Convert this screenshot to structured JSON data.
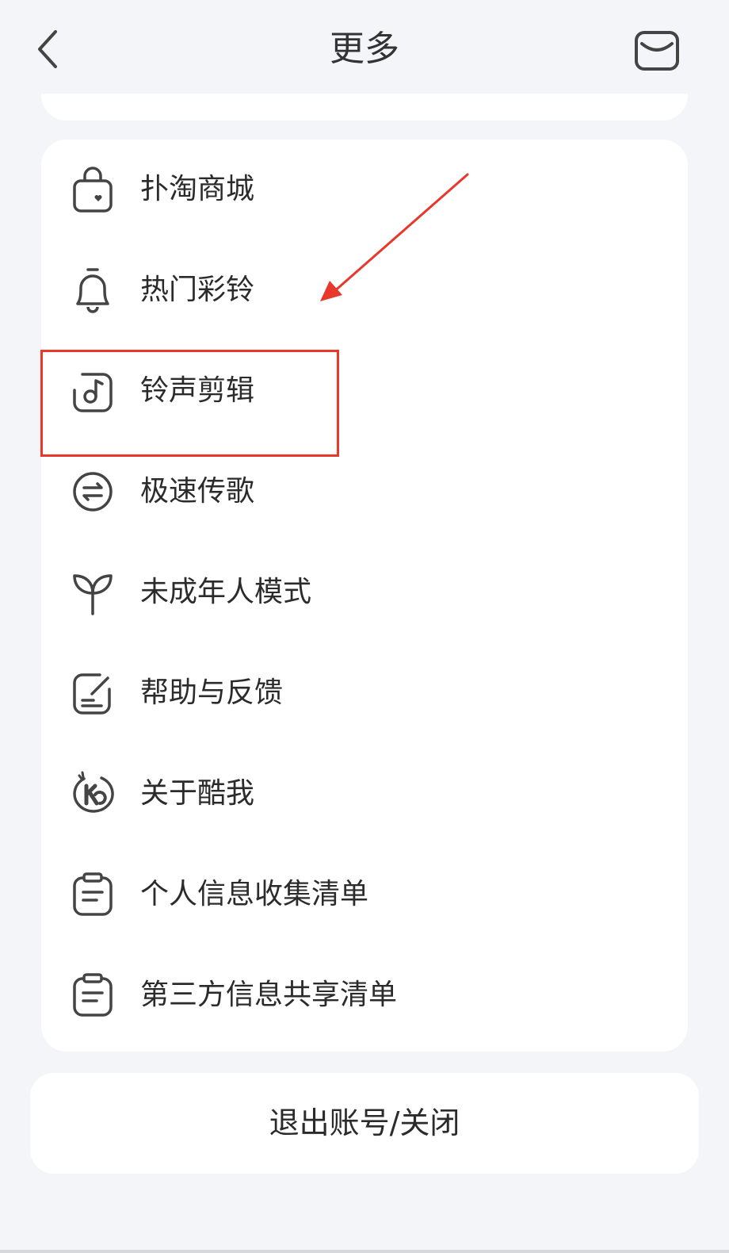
{
  "header": {
    "title": "更多",
    "back_icon": "chevron-left-icon",
    "mail_icon": "mail-icon"
  },
  "menu": {
    "items": [
      {
        "label": "扑淘商城",
        "icon": "shopping-bag-icon"
      },
      {
        "label": "热门彩铃",
        "icon": "bell-icon"
      },
      {
        "label": "铃声剪辑",
        "icon": "music-note-icon"
      },
      {
        "label": "极速传歌",
        "icon": "transfer-icon"
      },
      {
        "label": "未成年人模式",
        "icon": "sprout-icon"
      },
      {
        "label": "帮助与反馈",
        "icon": "feedback-icon"
      },
      {
        "label": "关于酷我",
        "icon": "kuwo-logo-icon"
      },
      {
        "label": "个人信息收集清单",
        "icon": "clipboard-icon"
      },
      {
        "label": "第三方信息共享清单",
        "icon": "clipboard-icon"
      }
    ]
  },
  "footer": {
    "logout_label": "退出账号/关闭"
  },
  "annotation": {
    "highlight_color": "#e8372b",
    "highlighted_item": "铃声剪辑"
  }
}
